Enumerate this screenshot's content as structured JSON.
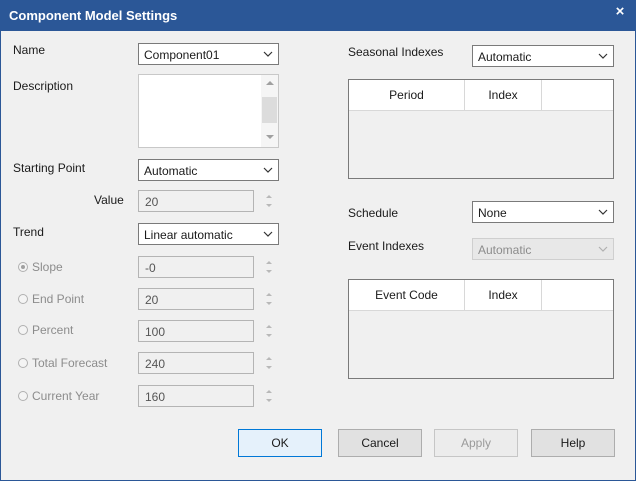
{
  "window": {
    "title": "Component Model Settings",
    "close_glyph": "×"
  },
  "left": {
    "name_label": "Name",
    "name_value": "Component01",
    "description_label": "Description",
    "starting_point_label": "Starting Point",
    "starting_point_value": "Automatic",
    "value_label": "Value",
    "value_value": "20",
    "trend_label": "Trend",
    "trend_value": "Linear automatic",
    "options": [
      {
        "label": "Slope",
        "value": "-0",
        "checked": true
      },
      {
        "label": "End Point",
        "value": "20",
        "checked": false
      },
      {
        "label": "Percent",
        "value": "100",
        "checked": false
      },
      {
        "label": "Total Forecast",
        "value": "240",
        "checked": false
      },
      {
        "label": "Current Year",
        "value": "160",
        "checked": false
      }
    ]
  },
  "right": {
    "seasonal_label": "Seasonal Indexes",
    "seasonal_value": "Automatic",
    "seasonal_columns": [
      "Period",
      "Index"
    ],
    "schedule_label": "Schedule",
    "schedule_value": "None",
    "event_label": "Event Indexes",
    "event_value": "Automatic",
    "event_columns": [
      "Event Code",
      "Index"
    ]
  },
  "buttons": {
    "ok": "OK",
    "cancel": "Cancel",
    "apply": "Apply",
    "help": "Help"
  },
  "colors": {
    "title_bar": "#2b5797",
    "dialog_bg": "#f0f0f0",
    "default_button_border": "#0078d7"
  },
  "icons": [
    "close-icon",
    "chevron-down-icon",
    "spin-up-icon",
    "spin-down-icon",
    "radio-icon"
  ]
}
